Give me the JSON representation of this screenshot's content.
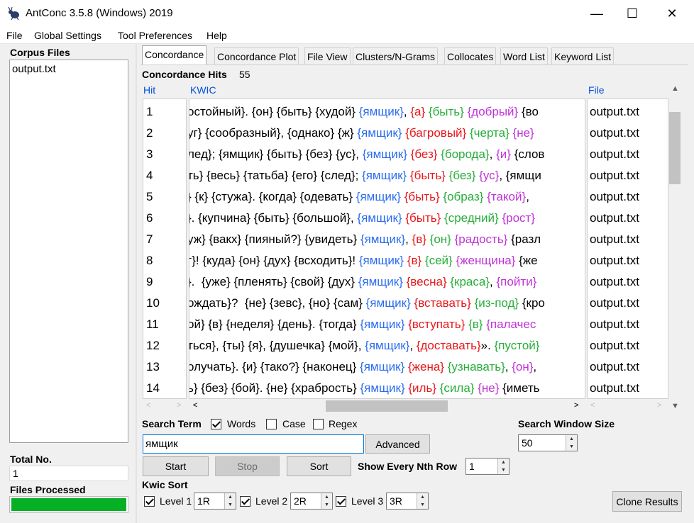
{
  "window": {
    "title": "AntConc 3.5.8 (Windows) 2019",
    "minimize": "—",
    "maximize": "☐",
    "close": "✕"
  },
  "menu": [
    "File",
    "Global Settings",
    "Tool Preferences",
    "Help"
  ],
  "left": {
    "corpus_files_label": "Corpus Files",
    "corpus_files": [
      "output.txt"
    ],
    "total_no_label": "Total No.",
    "total_no": "1",
    "files_processed_label": "Files Processed",
    "files_processed_fraction": 1.0,
    "progress_color": "#06b025"
  },
  "tabs": [
    "Concordance",
    "Concordance Plot",
    "File View",
    "Clusters/N-Grams",
    "Collocates",
    "Word List",
    "Keyword List"
  ],
  "active_tab": "Concordance",
  "concordance": {
    "hits_label": "Concordance Hits",
    "hits_count": "55",
    "col_hit": "Hit",
    "col_kwic": "KWIC",
    "col_file": "File",
    "rows": [
      {
        "hit": "1",
        "left": "остойный}. {он} {быть} {худой} ",
        "node": "{ямщик}",
        "mid": ", ",
        "r1": "{а}",
        "s1": " ",
        "r2": "{быть}",
        "s2": " ",
        "r3": "{добрый}",
        "rest": " {во",
        "file": "output.txt"
      },
      {
        "hit": "2",
        "left": "уг} {сообразный}, {однако} {ж} ",
        "node": "{ямщик}",
        "mid": " ",
        "r1": "{багровый}",
        "s1": " ",
        "r2": "{черта}",
        "s2": " ",
        "r3": "{не}",
        "rest": "",
        "file": "output.txt"
      },
      {
        "hit": "3",
        "left": "лед}; {ямщик} {быть} {без} {ус}, ",
        "node": "{ямщик}",
        "mid": " ",
        "r1": "{без}",
        "s1": " ",
        "r2": "{борода}",
        "s2": ", ",
        "r3": "{и}",
        "rest": " {слов",
        "file": "output.txt"
      },
      {
        "hit": "4",
        "left": "ть} {весь} {татьба} {его} {след}; ",
        "node": "{ямщик}",
        "mid": " ",
        "r1": "{быть}",
        "s1": " ",
        "r2": "{без}",
        "s2": " ",
        "r3": "{ус}",
        "rest": ", {ямщи",
        "file": "output.txt"
      },
      {
        "hit": "5",
        "left": "} {к} {стужа}. {когда} {одевать} ",
        "node": "{ямщик}",
        "mid": " ",
        "r1": "{быть}",
        "s1": " ",
        "r2": "{образ}",
        "s2": " ",
        "r3": "{такой}",
        "rest": ", ",
        "file": "output.txt"
      },
      {
        "hit": "6",
        "left": "}. {купчина} {быть} {большой}, ",
        "node": "{ямщик}",
        "mid": " ",
        "r1": "{быть}",
        "s1": " ",
        "r2": "{средний}",
        "s2": " ",
        "r3": "{рост}",
        "rest": "",
        "file": "output.txt"
      },
      {
        "hit": "7",
        "left": "уж} {вакх} {пияный?} {увидеть} ",
        "node": "{ямщик}",
        "mid": ", ",
        "r1": "{в}",
        "s1": " ",
        "r2": "{он}",
        "s2": " ",
        "r3": "{радость}",
        "rest": " {разл",
        "file": "output.txt"
      },
      {
        "hit": "8",
        "left": "г}! {куда} {он} {дух} {всходить}! ",
        "node": "{ямщик}",
        "mid": " ",
        "r1": "{в}",
        "s1": " ",
        "r2": "{сей}",
        "s2": " ",
        "r3": "{женщина}",
        "rest": " {же",
        "file": "output.txt"
      },
      {
        "hit": "9",
        "left": "}.  {уже} {пленять} {свой} {дух} ",
        "node": "{ямщик}",
        "mid": " ",
        "r1": "{весна}",
        "s1": " ",
        "r2": "{краса}",
        "s2": ", ",
        "r3": "{пойти}",
        "rest": "",
        "file": "output.txt"
      },
      {
        "hit": "10",
        "left": "ождать}?  {не} {зевс}, {но} {сам} ",
        "node": "{ямщик}",
        "mid": " ",
        "r1": "{вставать}",
        "s1": " ",
        "r2": "{из-под}",
        "s2": " ",
        "r3": "",
        "rest": "{кро",
        "file": "output.txt"
      },
      {
        "hit": "11",
        "left": "ой} {в} {неделя} {день}. {тогда} ",
        "node": "{ямщик}",
        "mid": " ",
        "r1": "{вступать}",
        "s1": " ",
        "r2": "{в}",
        "s2": " ",
        "r3": "{палачес",
        "rest": "",
        "file": "output.txt"
      },
      {
        "hit": "12",
        "left": "ться}, {ты} {я}, {душечка} {мой}, ",
        "node": "{ямщик}",
        "mid": ", ",
        "r1": "{доставать}",
        "s1": "». ",
        "r2": "{пустой}",
        "s2": "",
        "r3": "",
        "rest": "",
        "file": "output.txt"
      },
      {
        "hit": "13",
        "left": "олучать}. {и} {тако?} {наконец} ",
        "node": "{ямщик}",
        "mid": " ",
        "r1": "{жена}",
        "s1": " ",
        "r2": "{узнавать}",
        "s2": ", ",
        "r3": "{он}",
        "rest": ", ",
        "file": "output.txt"
      },
      {
        "hit": "14",
        "left": "ь} {без} {бой}. {не} {храбрость} ",
        "node": "{ямщик}",
        "mid": " ",
        "r1": "{иль}",
        "s1": " ",
        "r2": "{сила}",
        "s2": " ",
        "r3": "{не}",
        "rest": " {иметь",
        "file": "output.txt"
      }
    ]
  },
  "search": {
    "term_label": "Search Term",
    "words_label": "Words",
    "words_checked": true,
    "case_label": "Case",
    "case_checked": false,
    "regex_label": "Regex",
    "regex_checked": false,
    "value": "ямщик",
    "advanced_label": "Advanced",
    "window_size_label": "Search Window Size",
    "window_size": "50"
  },
  "buttons": {
    "start": "Start",
    "stop": "Stop",
    "sort": "Sort",
    "clone": "Clone Results"
  },
  "nth_row": {
    "label": "Show Every Nth Row",
    "value": "1"
  },
  "kwic_sort": {
    "label": "Kwic Sort",
    "levels": [
      {
        "label": "Level 1",
        "value": "1R",
        "checked": true
      },
      {
        "label": "Level 2",
        "value": "2R",
        "checked": true
      },
      {
        "label": "Level 3",
        "value": "3R",
        "checked": true
      }
    ]
  },
  "colors": {
    "node": "#2a6cf0",
    "r1": "#e8171b",
    "r2": "#27ae3a",
    "r3": "#c032d8",
    "header_link": "#0050e0"
  }
}
